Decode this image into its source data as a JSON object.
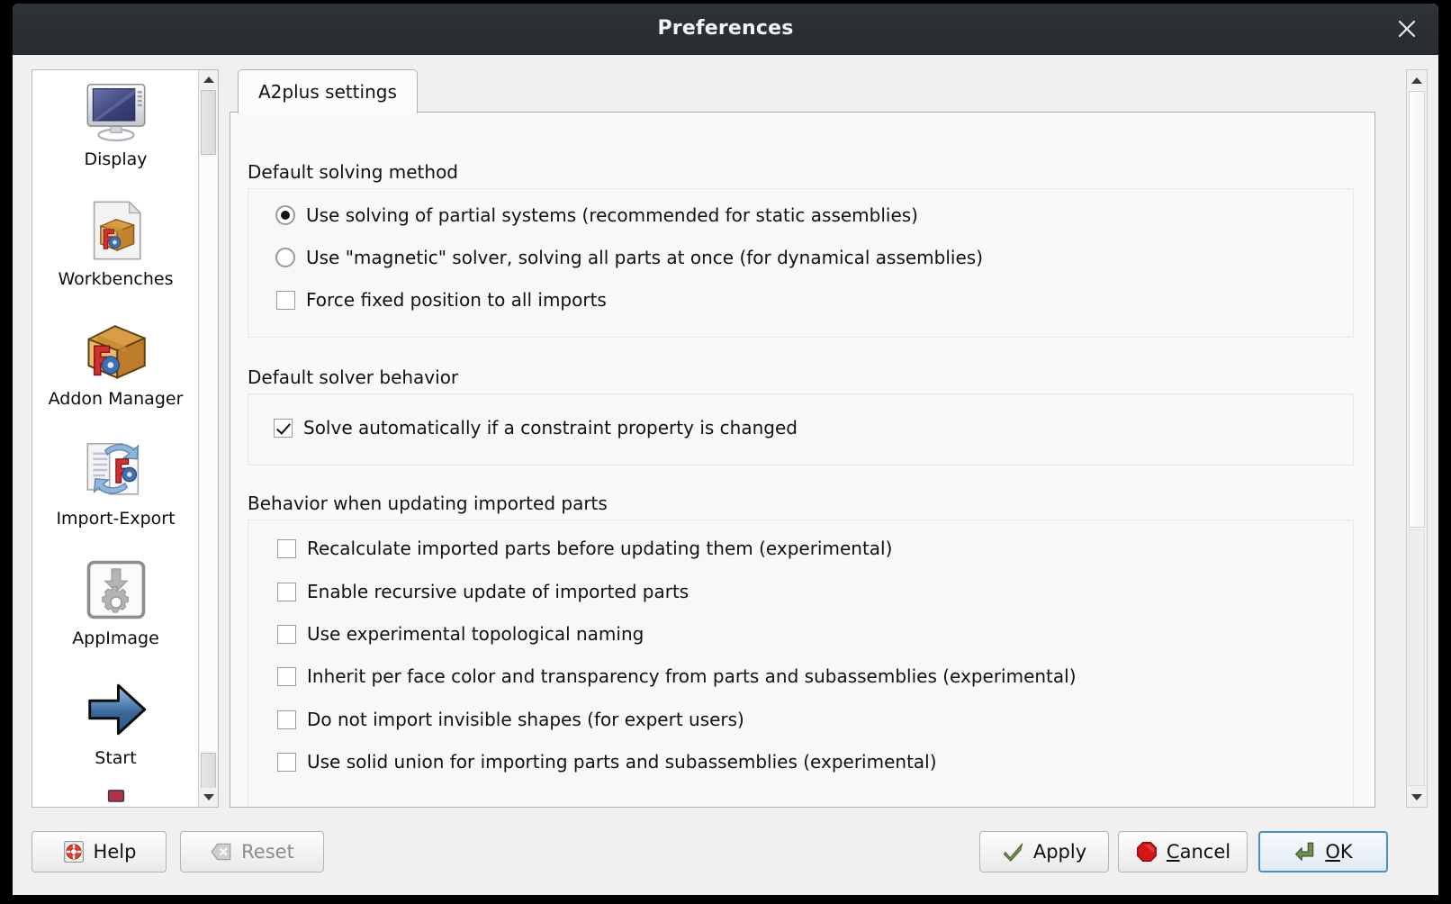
{
  "window": {
    "title": "Preferences",
    "close_icon": "close-icon"
  },
  "sidebar": {
    "items": [
      {
        "label": "Display",
        "icon": "monitor-icon"
      },
      {
        "label": "Workbenches",
        "icon": "workbenches-box-document-icon"
      },
      {
        "label": "Addon Manager",
        "icon": "addon-box-icon"
      },
      {
        "label": "Import-Export",
        "icon": "import-export-icon"
      },
      {
        "label": "AppImage",
        "icon": "appimage-download-gear-icon"
      },
      {
        "label": "Start",
        "icon": "blue-right-arrow-icon"
      }
    ],
    "scrollbar": {
      "up_arrow_icon": "scroll-up-arrow-icon",
      "down_arrow_icon": "scroll-down-arrow-icon"
    }
  },
  "panel": {
    "tabs": [
      {
        "label": "A2plus settings",
        "selected": true
      }
    ],
    "groups": [
      {
        "title": "Default solving method",
        "options": [
          {
            "type": "radio",
            "label": "Use solving of partial systems (recommended for static assemblies)",
            "checked": true
          },
          {
            "type": "radio",
            "label": "Use \"magnetic\" solver, solving all parts at once (for dynamical assemblies)",
            "checked": false
          },
          {
            "type": "checkbox",
            "label": "Force fixed position to all imports",
            "checked": false
          }
        ]
      },
      {
        "title": "Default solver behavior",
        "options": [
          {
            "type": "checkbox",
            "label": "Solve automatically if a constraint property is changed",
            "checked": true
          }
        ]
      },
      {
        "title": "Behavior when updating imported parts",
        "options": [
          {
            "type": "checkbox",
            "label": "Recalculate imported parts before updating them (experimental)",
            "checked": false
          },
          {
            "type": "checkbox",
            "label": "Enable recursive update of imported parts",
            "checked": false
          },
          {
            "type": "checkbox",
            "label": "Use experimental topological naming",
            "checked": false
          },
          {
            "type": "checkbox",
            "label": "Inherit per face color and transparency from parts and subassemblies (experimental)",
            "checked": false
          },
          {
            "type": "checkbox",
            "label": "Do not import invisible shapes (for expert users)",
            "checked": false
          },
          {
            "type": "checkbox",
            "label": "Use solid union for importing parts and subassemblies (experimental)",
            "checked": false
          }
        ]
      }
    ],
    "scrollbar": {
      "up_arrow_icon": "scroll-up-arrow-icon",
      "down_arrow_icon": "scroll-down-arrow-icon"
    }
  },
  "footer": {
    "help_label": "Help",
    "help_icon": "lifebuoy-icon",
    "reset_label": "Reset",
    "reset_icon": "backspace-icon",
    "apply_label": "Apply",
    "apply_icon": "green-check-icon",
    "cancel_label": "Cancel",
    "cancel_label_accel": "C",
    "cancel_label_rest": "ancel",
    "cancel_icon": "red-stop-octagon-icon",
    "ok_label": "OK",
    "ok_label_accel": "O",
    "ok_label_rest": "K",
    "ok_icon": "green-enter-arrow-icon"
  },
  "colors": {
    "titlebar_bg": "#282c2e",
    "dialog_bg": "#f0f0f0",
    "page_bg": "#fafafa",
    "group_bg": "#f8f8f8",
    "accent_focus": "#4a8ec2",
    "apply_green": "#6f8f52",
    "cancel_red": "#cc1111"
  }
}
